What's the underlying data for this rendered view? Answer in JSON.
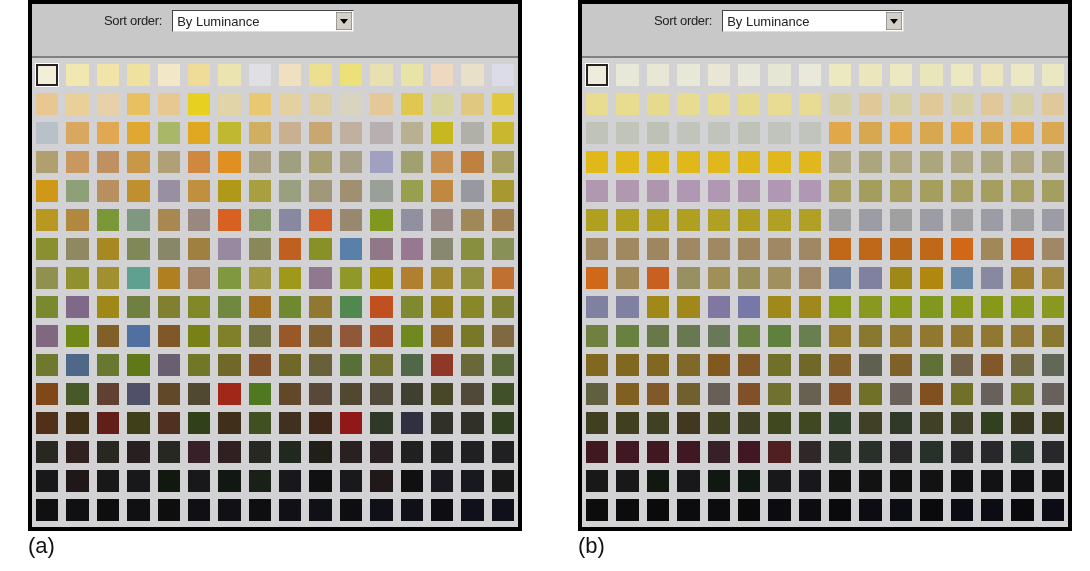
{
  "panels": [
    {
      "caption": "(a)",
      "sort_label": "Sort order:",
      "sort_value": "By Luminance",
      "first_swatch_selected": true,
      "rows": [
        [
          {
            "color": "#f2eed8"
          },
          {
            "color": "#f0e8b0"
          },
          {
            "color": "#f0e4a8"
          },
          {
            "color": "#efe2a0"
          },
          {
            "color": "#f2e8c8"
          },
          {
            "color": "#efdc98"
          },
          {
            "color": "#ece4b0"
          },
          {
            "color": "#e0e0e4"
          },
          {
            "color": "#efe0c0"
          },
          {
            "color": "#ece090"
          },
          {
            "color": "#ece078"
          },
          {
            "color": "#e8e0b0"
          },
          {
            "color": "#e8e4a8"
          },
          {
            "color": "#eed8c0"
          },
          {
            "color": "#e8e0c8"
          },
          {
            "color": "#dcdce8"
          }
        ],
        [
          {
            "color": "#e8c890"
          },
          {
            "color": "#e8d098"
          },
          {
            "color": "#e8d0a8"
          },
          {
            "color": "#e8c060"
          },
          {
            "color": "#e8c891"
          },
          {
            "color": "#e8d020"
          },
          {
            "color": "#e0d4a8"
          },
          {
            "color": "#e8c870"
          },
          {
            "color": "#e4d0a0"
          },
          {
            "color": "#e0d0a0"
          },
          {
            "color": "#d8d4c0"
          },
          {
            "color": "#e4c898"
          },
          {
            "color": "#e0c850"
          },
          {
            "color": "#d8d4a0"
          },
          {
            "color": "#e0c880"
          },
          {
            "color": "#e0c840"
          }
        ],
        [
          {
            "color": "#b8c0c8"
          },
          {
            "color": "#d8a860"
          },
          {
            "color": "#e0a850"
          },
          {
            "color": "#e0a830"
          },
          {
            "color": "#a8b868"
          },
          {
            "color": "#e0a820"
          },
          {
            "color": "#c0b830"
          },
          {
            "color": "#d0b060"
          },
          {
            "color": "#c8b090"
          },
          {
            "color": "#c8a870"
          },
          {
            "color": "#c0b0a0"
          },
          {
            "color": "#b8b0b0"
          },
          {
            "color": "#b8b090"
          },
          {
            "color": "#c8b820"
          },
          {
            "color": "#b0b0a8"
          },
          {
            "color": "#c8b830"
          }
        ],
        [
          {
            "color": "#b0a070"
          },
          {
            "color": "#c89860"
          },
          {
            "color": "#c09060"
          },
          {
            "color": "#c89848"
          },
          {
            "color": "#b0a078"
          },
          {
            "color": "#d08840"
          },
          {
            "color": "#e09020"
          },
          {
            "color": "#a8a080"
          },
          {
            "color": "#a0a080"
          },
          {
            "color": "#a8a070"
          },
          {
            "color": "#a8a088"
          },
          {
            "color": "#a0a0c0"
          },
          {
            "color": "#a0a070"
          },
          {
            "color": "#c89050"
          },
          {
            "color": "#c08040"
          },
          {
            "color": "#a8a060"
          }
        ],
        [
          {
            "color": "#d09818"
          },
          {
            "color": "#8ea078"
          },
          {
            "color": "#b89060"
          },
          {
            "color": "#c09030"
          },
          {
            "color": "#9890a0"
          },
          {
            "color": "#c09040"
          },
          {
            "color": "#b09818"
          },
          {
            "color": "#a8a040"
          },
          {
            "color": "#98a080"
          },
          {
            "color": "#a09878"
          },
          {
            "color": "#a09070"
          },
          {
            "color": "#98a098"
          },
          {
            "color": "#98a050"
          },
          {
            "color": "#c08840"
          },
          {
            "color": "#9898a0"
          },
          {
            "color": "#a89830"
          }
        ],
        [
          {
            "color": "#b89820"
          },
          {
            "color": "#b08840"
          },
          {
            "color": "#7a9838"
          },
          {
            "color": "#809880"
          },
          {
            "color": "#a88850"
          },
          {
            "color": "#988880"
          },
          {
            "color": "#d86020"
          },
          {
            "color": "#889868"
          },
          {
            "color": "#8888a0"
          },
          {
            "color": "#d06028"
          },
          {
            "color": "#988870"
          },
          {
            "color": "#809820"
          },
          {
            "color": "#9090a0"
          },
          {
            "color": "#988888"
          },
          {
            "color": "#a08858"
          },
          {
            "color": "#a08050"
          }
        ],
        [
          {
            "color": "#8a9030"
          },
          {
            "color": "#908860"
          },
          {
            "color": "#a88820"
          },
          {
            "color": "#808858"
          },
          {
            "color": "#888868"
          },
          {
            "color": "#a08040"
          },
          {
            "color": "#9888a0"
          },
          {
            "color": "#888858"
          },
          {
            "color": "#c06020"
          },
          {
            "color": "#889028"
          },
          {
            "color": "#5880a8"
          },
          {
            "color": "#907888"
          },
          {
            "color": "#987890"
          },
          {
            "color": "#888870"
          },
          {
            "color": "#889040"
          },
          {
            "color": "#889058"
          }
        ],
        [
          {
            "color": "#909050"
          },
          {
            "color": "#909030"
          },
          {
            "color": "#a09030"
          },
          {
            "color": "#60a090"
          },
          {
            "color": "#b08020"
          },
          {
            "color": "#a08060"
          },
          {
            "color": "#809840"
          },
          {
            "color": "#a09840"
          },
          {
            "color": "#a09818"
          },
          {
            "color": "#907890"
          },
          {
            "color": "#909828"
          },
          {
            "color": "#a09010"
          },
          {
            "color": "#b08030"
          },
          {
            "color": "#a08830"
          },
          {
            "color": "#909040"
          },
          {
            "color": "#c07030"
          }
        ],
        [
          {
            "color": "#7a8830"
          },
          {
            "color": "#806888"
          },
          {
            "color": "#a08818"
          },
          {
            "color": "#708040"
          },
          {
            "color": "#808030"
          },
          {
            "color": "#808828"
          },
          {
            "color": "#708840"
          },
          {
            "color": "#a07020"
          },
          {
            "color": "#708830"
          },
          {
            "color": "#907830"
          },
          {
            "color": "#508850"
          },
          {
            "color": "#c05020"
          },
          {
            "color": "#808831"
          },
          {
            "color": "#908020"
          },
          {
            "color": "#888828"
          },
          {
            "color": "#808032"
          }
        ],
        [
          {
            "color": "#806880"
          },
          {
            "color": "#708818"
          },
          {
            "color": "#806028"
          },
          {
            "color": "#5070a0"
          },
          {
            "color": "#805828"
          },
          {
            "color": "#788018"
          },
          {
            "color": "#808028"
          },
          {
            "color": "#707040"
          },
          {
            "color": "#985828"
          },
          {
            "color": "#806030"
          },
          {
            "color": "#905838"
          },
          {
            "color": "#a05028"
          },
          {
            "color": "#708820"
          },
          {
            "color": "#906028"
          },
          {
            "color": "#787828"
          },
          {
            "color": "#806840"
          }
        ],
        [
          {
            "color": "#707830"
          },
          {
            "color": "#506888"
          },
          {
            "color": "#687830"
          },
          {
            "color": "#607818"
          },
          {
            "color": "#686070"
          },
          {
            "color": "#707828"
          },
          {
            "color": "#706828"
          },
          {
            "color": "#805028"
          },
          {
            "color": "#706829"
          },
          {
            "color": "#686038"
          },
          {
            "color": "#587038"
          },
          {
            "color": "#707030"
          },
          {
            "color": "#506848"
          },
          {
            "color": "#903828"
          },
          {
            "color": "#686838"
          },
          {
            "color": "#586838"
          }
        ],
        [
          {
            "color": "#804818"
          },
          {
            "color": "#485828"
          },
          {
            "color": "#604030"
          },
          {
            "color": "#505068"
          },
          {
            "color": "#604828"
          },
          {
            "color": "#504830"
          },
          {
            "color": "#a02818"
          },
          {
            "color": "#507820"
          },
          {
            "color": "#604829"
          },
          {
            "color": "#584838"
          },
          {
            "color": "#504831"
          },
          {
            "color": "#504838"
          },
          {
            "color": "#404030"
          },
          {
            "color": "#484828"
          },
          {
            "color": "#504839"
          },
          {
            "color": "#405028"
          }
        ],
        [
          {
            "color": "#503018"
          },
          {
            "color": "#403018"
          },
          {
            "color": "#602018"
          },
          {
            "color": "#404018"
          },
          {
            "color": "#503020"
          },
          {
            "color": "#304018"
          },
          {
            "color": "#403019"
          },
          {
            "color": "#405020"
          },
          {
            "color": "#403020"
          },
          {
            "color": "#402818"
          },
          {
            "color": "#901818"
          },
          {
            "color": "#303828"
          },
          {
            "color": "#303040"
          },
          {
            "color": "#303028"
          },
          {
            "color": "#303029"
          },
          {
            "color": "#304020"
          }
        ],
        [
          {
            "color": "#282820"
          },
          {
            "color": "#302020"
          },
          {
            "color": "#282821"
          },
          {
            "color": "#282020"
          },
          {
            "color": "#282822"
          },
          {
            "color": "#382028"
          },
          {
            "color": "#302021"
          },
          {
            "color": "#282823"
          },
          {
            "color": "#202820"
          },
          {
            "color": "#202018"
          },
          {
            "color": "#282021"
          },
          {
            "color": "#282022"
          },
          {
            "color": "#202020"
          },
          {
            "color": "#202021"
          },
          {
            "color": "#202022"
          },
          {
            "color": "#202023"
          }
        ],
        [
          {
            "color": "#181818"
          },
          {
            "color": "#201818"
          },
          {
            "color": "#181819"
          },
          {
            "color": "#18181a"
          },
          {
            "color": "#101810"
          },
          {
            "color": "#18181b"
          },
          {
            "color": "#101811"
          },
          {
            "color": "#182018"
          },
          {
            "color": "#18181c"
          },
          {
            "color": "#101010"
          },
          {
            "color": "#18181d"
          },
          {
            "color": "#201819"
          },
          {
            "color": "#101011"
          },
          {
            "color": "#18181e"
          },
          {
            "color": "#18181f"
          },
          {
            "color": "#191818"
          }
        ],
        [
          {
            "color": "#101010"
          },
          {
            "color": "#101012"
          },
          {
            "color": "#0e0e0e"
          },
          {
            "color": "#101013"
          },
          {
            "color": "#0e0e0f"
          },
          {
            "color": "#101014"
          },
          {
            "color": "#101015"
          },
          {
            "color": "#0e0e10"
          },
          {
            "color": "#101016"
          },
          {
            "color": "#101017"
          },
          {
            "color": "#0e0e11"
          },
          {
            "color": "#101018"
          },
          {
            "color": "#101019"
          },
          {
            "color": "#0e0e12"
          },
          {
            "color": "#10101a"
          },
          {
            "color": "#10101b"
          }
        ]
      ]
    },
    {
      "caption": "(b)",
      "sort_label": "Sort order:",
      "sort_value": "By Luminance",
      "first_swatch_selected": true,
      "rows": [
        [
          {
            "color": "#f0ecdc"
          },
          {
            "color": "#e8e8d8"
          },
          {
            "color": "#e8e6d4"
          },
          {
            "color": "#e8e8d9"
          },
          {
            "color": "#eae6d6"
          },
          {
            "color": "#e8e8da"
          },
          {
            "color": "#e6e6d4"
          },
          {
            "color": "#e8e8db"
          },
          {
            "color": "#ece8c0"
          },
          {
            "color": "#ece6bc"
          },
          {
            "color": "#ece8c1"
          },
          {
            "color": "#eae6bc"
          },
          {
            "color": "#ece8c2"
          },
          {
            "color": "#ece6bd"
          },
          {
            "color": "#ece8c3"
          },
          {
            "color": "#eae8c0"
          }
        ],
        [
          {
            "color": "#e8dc90"
          },
          {
            "color": "#e8dc91"
          },
          {
            "color": "#e6da8e"
          },
          {
            "color": "#e8dc92"
          },
          {
            "color": "#e8dc93"
          },
          {
            "color": "#e6da8f"
          },
          {
            "color": "#e8dc94"
          },
          {
            "color": "#e8dc95"
          },
          {
            "color": "#d8d0a0"
          },
          {
            "color": "#e0c898"
          },
          {
            "color": "#d8d0a1"
          },
          {
            "color": "#e0c899"
          },
          {
            "color": "#d8d0a2"
          },
          {
            "color": "#e0c89a"
          },
          {
            "color": "#d8d0a3"
          },
          {
            "color": "#e0c89b"
          }
        ],
        [
          {
            "color": "#c0c4b8"
          },
          {
            "color": "#c0c4b9"
          },
          {
            "color": "#bec2b6"
          },
          {
            "color": "#c0c4ba"
          },
          {
            "color": "#c0c4bb"
          },
          {
            "color": "#bec2b7"
          },
          {
            "color": "#c0c4bc"
          },
          {
            "color": "#c0c4bd"
          },
          {
            "color": "#e0a848"
          },
          {
            "color": "#d8a850"
          },
          {
            "color": "#e0a849"
          },
          {
            "color": "#d8a851"
          },
          {
            "color": "#e0a84a"
          },
          {
            "color": "#d8a852"
          },
          {
            "color": "#e0a84b"
          },
          {
            "color": "#d8a853"
          }
        ],
        [
          {
            "color": "#e0b818"
          },
          {
            "color": "#e0b819"
          },
          {
            "color": "#deb618"
          },
          {
            "color": "#e0b81a"
          },
          {
            "color": "#e0b81b"
          },
          {
            "color": "#deb619"
          },
          {
            "color": "#e0b81c"
          },
          {
            "color": "#e0b81d"
          },
          {
            "color": "#b0a880"
          },
          {
            "color": "#aca67e"
          },
          {
            "color": "#b0a881"
          },
          {
            "color": "#aca67f"
          },
          {
            "color": "#b0a882"
          },
          {
            "color": "#aca680"
          },
          {
            "color": "#b0a883"
          },
          {
            "color": "#aca681"
          }
        ],
        [
          {
            "color": "#b098b0"
          },
          {
            "color": "#b098b1"
          },
          {
            "color": "#ae96ae"
          },
          {
            "color": "#b098b2"
          },
          {
            "color": "#b098b3"
          },
          {
            "color": "#ae96af"
          },
          {
            "color": "#b098b4"
          },
          {
            "color": "#b098b5"
          },
          {
            "color": "#a8a060"
          },
          {
            "color": "#a49e5e"
          },
          {
            "color": "#a8a061"
          },
          {
            "color": "#a49e5f"
          },
          {
            "color": "#a8a062"
          },
          {
            "color": "#a49e60"
          },
          {
            "color": "#a8a063"
          },
          {
            "color": "#a49e61"
          }
        ],
        [
          {
            "color": "#b0a020"
          },
          {
            "color": "#b0a021"
          },
          {
            "color": "#ae9e20"
          },
          {
            "color": "#b0a022"
          },
          {
            "color": "#b0a023"
          },
          {
            "color": "#ae9e21"
          },
          {
            "color": "#b0a024"
          },
          {
            "color": "#b0a025"
          },
          {
            "color": "#a0a0a0"
          },
          {
            "color": "#9c9ca4"
          },
          {
            "color": "#a0a0a1"
          },
          {
            "color": "#9c9ca5"
          },
          {
            "color": "#a0a0a2"
          },
          {
            "color": "#9c9ca6"
          },
          {
            "color": "#a0a0a3"
          },
          {
            "color": "#9c9ca7"
          }
        ],
        [
          {
            "color": "#a08860"
          },
          {
            "color": "#a08861"
          },
          {
            "color": "#9e865e"
          },
          {
            "color": "#a08862"
          },
          {
            "color": "#a08863"
          },
          {
            "color": "#9e865f"
          },
          {
            "color": "#a08864"
          },
          {
            "color": "#a08865"
          },
          {
            "color": "#c06818"
          },
          {
            "color": "#c06819"
          },
          {
            "color": "#b86818"
          },
          {
            "color": "#c0681a"
          },
          {
            "color": "#d06818"
          },
          {
            "color": "#a08858"
          },
          {
            "color": "#c86020"
          },
          {
            "color": "#a08866"
          }
        ],
        [
          {
            "color": "#d06819"
          },
          {
            "color": "#a08859"
          },
          {
            "color": "#c86021"
          },
          {
            "color": "#989060"
          },
          {
            "color": "#a09058"
          },
          {
            "color": "#989058"
          },
          {
            "color": "#a09060"
          },
          {
            "color": "#a08867"
          },
          {
            "color": "#7080a0"
          },
          {
            "color": "#8080a0"
          },
          {
            "color": "#a08818"
          },
          {
            "color": "#b08810"
          },
          {
            "color": "#6888a8"
          },
          {
            "color": "#8888a0"
          },
          {
            "color": "#a08030"
          },
          {
            "color": "#a08840"
          }
        ],
        [
          {
            "color": "#8080a1"
          },
          {
            "color": "#8080a2"
          },
          {
            "color": "#a08819"
          },
          {
            "color": "#a0881a"
          },
          {
            "color": "#8078a0"
          },
          {
            "color": "#7878a8"
          },
          {
            "color": "#a0881b"
          },
          {
            "color": "#a0881c"
          },
          {
            "color": "#889818"
          },
          {
            "color": "#889820"
          },
          {
            "color": "#889819"
          },
          {
            "color": "#809820"
          },
          {
            "color": "#88981a"
          },
          {
            "color": "#88981b"
          },
          {
            "color": "#88981c"
          },
          {
            "color": "#889821"
          }
        ],
        [
          {
            "color": "#708040"
          },
          {
            "color": "#688040"
          },
          {
            "color": "#687848"
          },
          {
            "color": "#687850"
          },
          {
            "color": "#687858"
          },
          {
            "color": "#688041"
          },
          {
            "color": "#608040"
          },
          {
            "color": "#688050"
          },
          {
            "color": "#907828"
          },
          {
            "color": "#887830"
          },
          {
            "color": "#907830"
          },
          {
            "color": "#907831"
          },
          {
            "color": "#907832"
          },
          {
            "color": "#907833"
          },
          {
            "color": "#907834"
          },
          {
            "color": "#887831"
          }
        ],
        [
          {
            "color": "#806820"
          },
          {
            "color": "#806821"
          },
          {
            "color": "#806822"
          },
          {
            "color": "#806828"
          },
          {
            "color": "#805820"
          },
          {
            "color": "#805828"
          },
          {
            "color": "#707028"
          },
          {
            "color": "#706828"
          },
          {
            "color": "#806028"
          },
          {
            "color": "#606050"
          },
          {
            "color": "#806029"
          },
          {
            "color": "#607038"
          },
          {
            "color": "#706048"
          },
          {
            "color": "#805829"
          },
          {
            "color": "#706840"
          },
          {
            "color": "#606858"
          }
        ],
        [
          {
            "color": "#606040"
          },
          {
            "color": "#806020"
          },
          {
            "color": "#80582a"
          },
          {
            "color": "#706030"
          },
          {
            "color": "#686058"
          },
          {
            "color": "#805028"
          },
          {
            "color": "#707030"
          },
          {
            "color": "#686050"
          },
          {
            "color": "#805029"
          },
          {
            "color": "#707029"
          },
          {
            "color": "#686059"
          },
          {
            "color": "#805020"
          },
          {
            "color": "#70702a"
          },
          {
            "color": "#68605a"
          },
          {
            "color": "#707031"
          },
          {
            "color": "#68605b"
          }
        ],
        [
          {
            "color": "#404020"
          },
          {
            "color": "#404021"
          },
          {
            "color": "#404022"
          },
          {
            "color": "#403820"
          },
          {
            "color": "#404023"
          },
          {
            "color": "#404024"
          },
          {
            "color": "#404820"
          },
          {
            "color": "#404821"
          },
          {
            "color": "#304028"
          },
          {
            "color": "#404025"
          },
          {
            "color": "#303828"
          },
          {
            "color": "#404026"
          },
          {
            "color": "#404028"
          },
          {
            "color": "#304020"
          },
          {
            "color": "#383820"
          },
          {
            "color": "#383821"
          }
        ],
        [
          {
            "color": "#401820"
          },
          {
            "color": "#401821"
          },
          {
            "color": "#401822"
          },
          {
            "color": "#401823"
          },
          {
            "color": "#382028"
          },
          {
            "color": "#401824"
          },
          {
            "color": "#502020"
          },
          {
            "color": "#302828"
          },
          {
            "color": "#283028"
          },
          {
            "color": "#283029"
          },
          {
            "color": "#282828"
          },
          {
            "color": "#28302a"
          },
          {
            "color": "#282829"
          },
          {
            "color": "#28282a"
          },
          {
            "color": "#28302b"
          },
          {
            "color": "#28282b"
          }
        ],
        [
          {
            "color": "#181818"
          },
          {
            "color": "#181819"
          },
          {
            "color": "#101810"
          },
          {
            "color": "#18181a"
          },
          {
            "color": "#101811"
          },
          {
            "color": "#101812"
          },
          {
            "color": "#18181b"
          },
          {
            "color": "#18181c"
          },
          {
            "color": "#101010"
          },
          {
            "color": "#121212"
          },
          {
            "color": "#101011"
          },
          {
            "color": "#121213"
          },
          {
            "color": "#101012"
          },
          {
            "color": "#121214"
          },
          {
            "color": "#101013"
          },
          {
            "color": "#121215"
          }
        ],
        [
          {
            "color": "#0c0c0c"
          },
          {
            "color": "#0c0c0d"
          },
          {
            "color": "#0a0a0a"
          },
          {
            "color": "#0c0c0e"
          },
          {
            "color": "#0c0c0f"
          },
          {
            "color": "#0a0a0b"
          },
          {
            "color": "#0c0c10"
          },
          {
            "color": "#0c0c11"
          },
          {
            "color": "#0a0a0c"
          },
          {
            "color": "#0c0c12"
          },
          {
            "color": "#0c0c13"
          },
          {
            "color": "#0a0a0d"
          },
          {
            "color": "#0c0c14"
          },
          {
            "color": "#0c0c15"
          },
          {
            "color": "#0a0a0e"
          },
          {
            "color": "#0c0c16"
          }
        ]
      ]
    }
  ]
}
